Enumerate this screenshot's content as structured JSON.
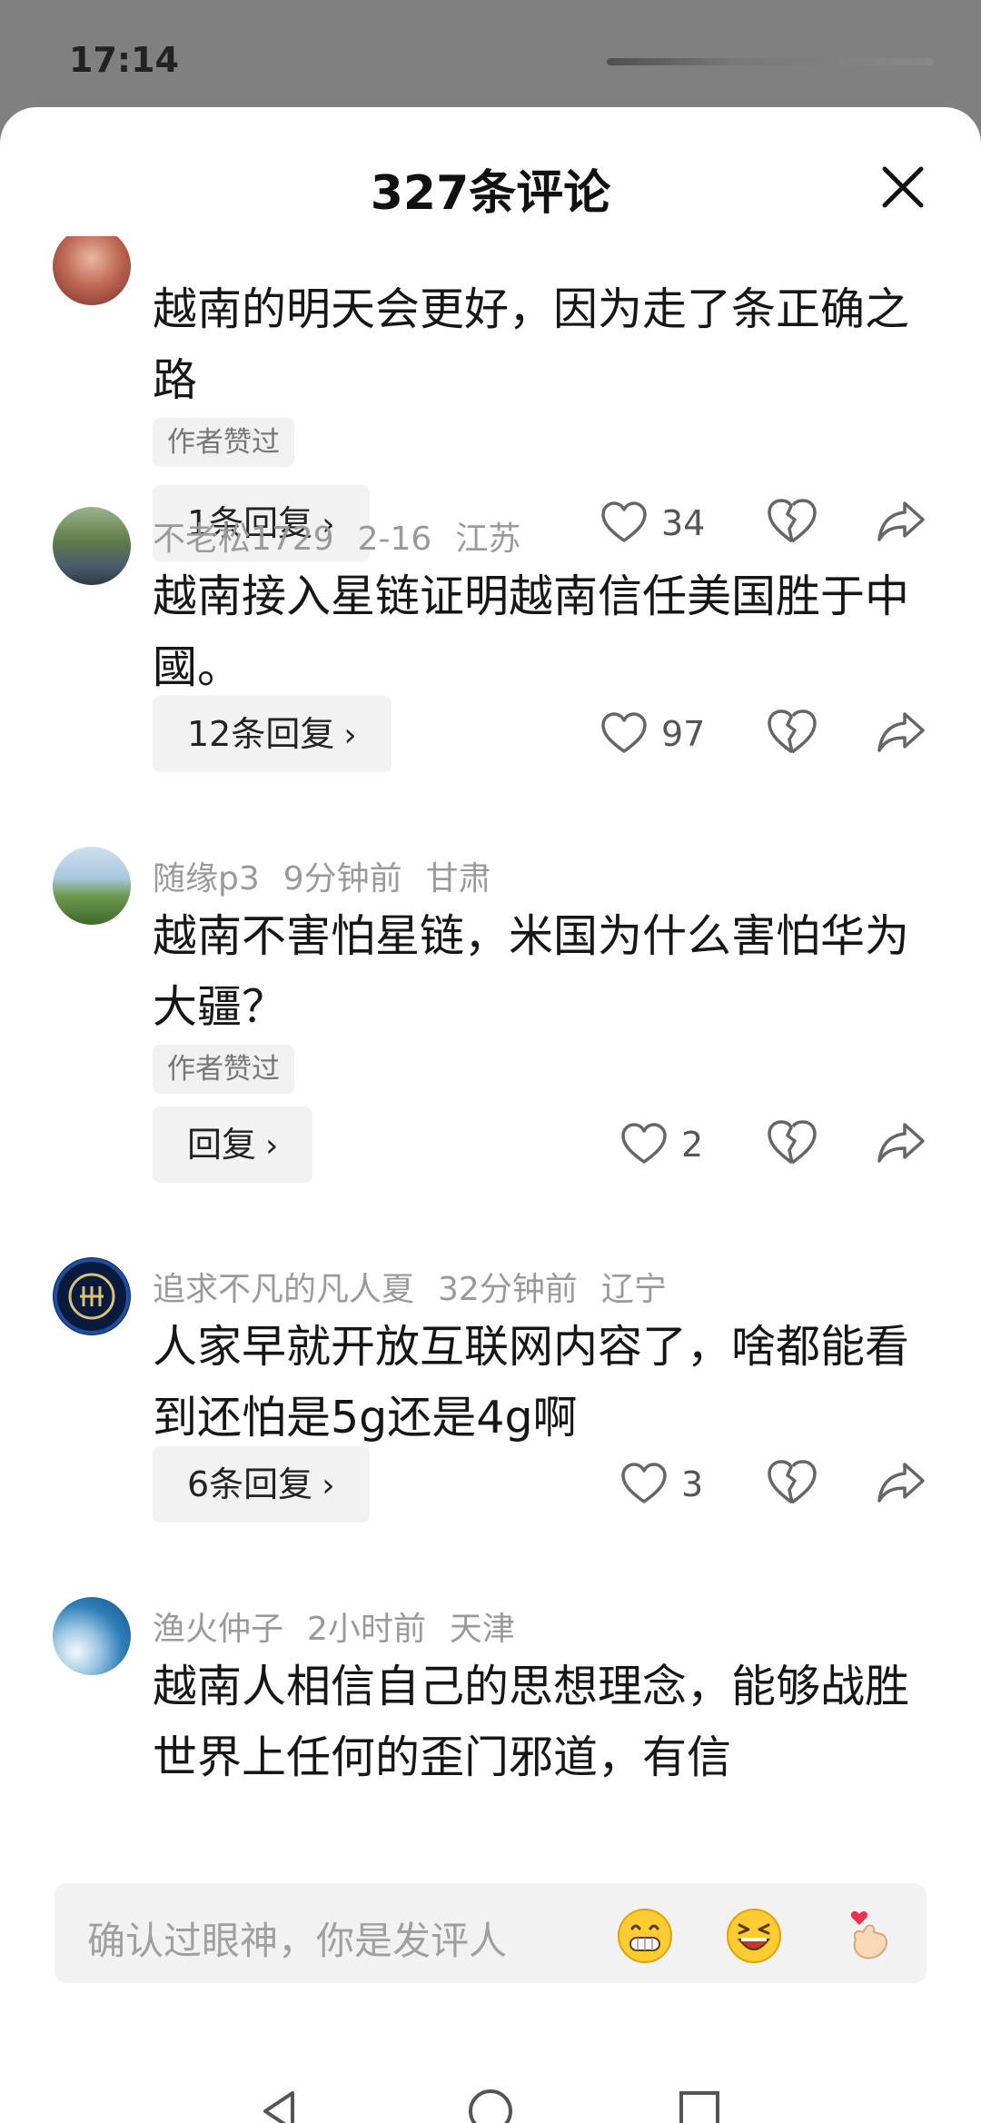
{
  "status": {
    "time": "17:14"
  },
  "header": {
    "title": "327条评论"
  },
  "comments": [
    {
      "user": "",
      "time": "",
      "location": "",
      "text": "越南的明天会更好，因为走了条正确之路",
      "badge": "作者赞过",
      "reply_label": "1条回复",
      "likes": "34"
    },
    {
      "user": "不老松1729",
      "time": "2-16",
      "location": "江苏",
      "text": "越南接入星链证明越南信任美国胜于中國。",
      "badge": "",
      "reply_label": "12条回复",
      "likes": "97"
    },
    {
      "user": "随缘p3",
      "time": "9分钟前",
      "location": "甘肃",
      "text": "越南不害怕星链，米国为什么害怕华为大疆？",
      "badge": "作者赞过",
      "reply_label": "回复",
      "likes": "2"
    },
    {
      "user": "追求不凡的凡人夏",
      "time": "32分钟前",
      "location": "辽宁",
      "text": "人家早就开放互联网内容了，啥都能看到还怕是5g还是4g啊",
      "badge": "",
      "reply_label": "6条回复",
      "likes": "3"
    },
    {
      "user": "渔火仲子",
      "time": "2小时前",
      "location": "天津",
      "text": "越南人相信自己的思想理念，能够战胜世界上任何的歪门邪道，有信",
      "badge": "",
      "reply_label": "",
      "likes": ""
    }
  ],
  "input": {
    "placeholder": "确认过眼神，你是发评人"
  },
  "icons": {
    "close": "close-icon",
    "like": "heart-icon",
    "dislike": "broken-heart-icon",
    "share": "share-arrow-icon",
    "emoji1": "grinning-emoji",
    "emoji2": "laughing-emoji",
    "emoji3": "finger-heart-emoji",
    "nav_back": "triangle-back-icon",
    "nav_home": "circle-home-icon",
    "nav_recent": "square-recent-icon"
  }
}
